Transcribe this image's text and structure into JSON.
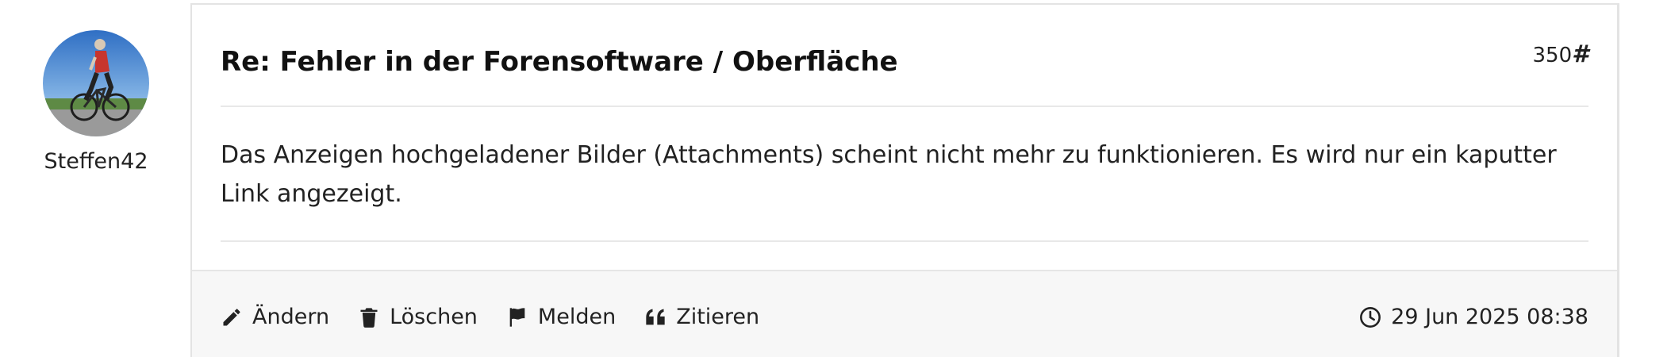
{
  "author": {
    "name": "Steffen42"
  },
  "post": {
    "title": "Re: Fehler in der Forensoftware / Oberfläche",
    "number": "350",
    "number_suffix": "#",
    "body": "Das Anzeigen hochgeladener Bilder (Attachments) scheint nicht mehr zu funktionieren. Es wird nur ein kaputter Link angezeigt.",
    "date": "29 Jun 2025 08:38"
  },
  "actions": {
    "edit": "Ändern",
    "delete": "Löschen",
    "report": "Melden",
    "quote": "Zitieren"
  },
  "icons": {
    "edit": "pencil-icon",
    "delete": "trash-icon",
    "report": "flag-icon",
    "quote": "quote-icon",
    "date": "clock-icon"
  },
  "colors": {
    "text": "#222222",
    "title": "#111111",
    "border": "#e3e3e3",
    "footer_bg": "#f7f7f7"
  }
}
